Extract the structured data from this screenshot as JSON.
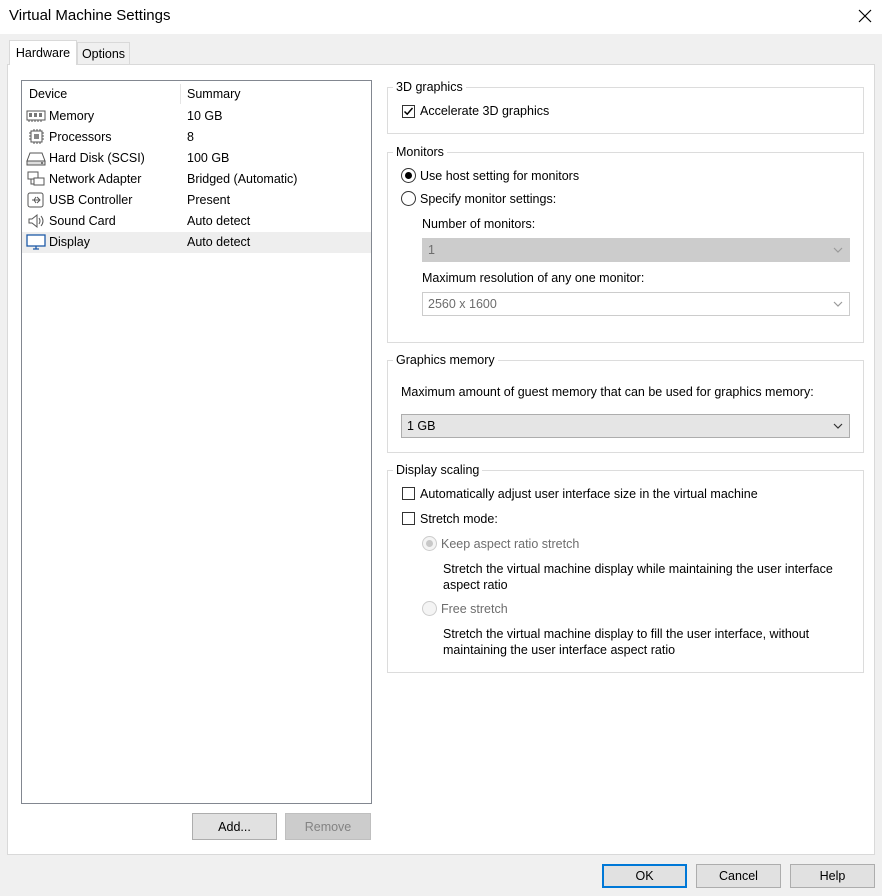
{
  "window": {
    "title": "Virtual Machine Settings"
  },
  "tabs": [
    {
      "label": "Hardware",
      "active": true
    },
    {
      "label": "Options",
      "active": false
    }
  ],
  "device_list": {
    "headers": {
      "device": "Device",
      "summary": "Summary"
    },
    "rows": [
      {
        "icon": "memory-icon",
        "name": "Memory",
        "summary": "10 GB"
      },
      {
        "icon": "processor-icon",
        "name": "Processors",
        "summary": "8"
      },
      {
        "icon": "hard-disk-icon",
        "name": "Hard Disk (SCSI)",
        "summary": "100 GB"
      },
      {
        "icon": "network-adapter-icon",
        "name": "Network Adapter",
        "summary": "Bridged (Automatic)"
      },
      {
        "icon": "usb-icon",
        "name": "USB Controller",
        "summary": "Present"
      },
      {
        "icon": "speaker-icon",
        "name": "Sound Card",
        "summary": "Auto detect"
      },
      {
        "icon": "monitor-icon",
        "name": "Display",
        "summary": "Auto detect",
        "selected": true
      }
    ]
  },
  "list_buttons": {
    "add": "Add...",
    "remove": "Remove"
  },
  "graphics3d": {
    "legend": "3D graphics",
    "accelerate_label": "Accelerate 3D graphics",
    "accelerate_checked": true
  },
  "monitors": {
    "legend": "Monitors",
    "use_host_label": "Use host setting for monitors",
    "specify_label": "Specify monitor settings:",
    "number_label": "Number of monitors:",
    "number_value": "1",
    "maxres_label": "Maximum resolution of any one monitor:",
    "maxres_value": "2560 x 1600"
  },
  "graphics_memory": {
    "legend": "Graphics memory",
    "description": "Maximum amount of guest memory that can be used for graphics memory:",
    "value": "1 GB"
  },
  "display_scaling": {
    "legend": "Display scaling",
    "auto_adjust_label": "Automatically adjust user interface size in the virtual machine",
    "stretch_label": "Stretch mode:",
    "keep_aspect_label": "Keep aspect ratio stretch",
    "keep_aspect_desc_1": "Stretch the virtual machine display while maintaining the user interface",
    "keep_aspect_desc_2": "aspect ratio",
    "free_label": "Free stretch",
    "free_desc_1": "Stretch the virtual machine display to fill the user interface, without",
    "free_desc_2": "maintaining the user interface aspect ratio"
  },
  "footer": {
    "ok": "OK",
    "cancel": "Cancel",
    "help": "Help"
  },
  "colors": {
    "accent": "#0078d7",
    "selected_row": "#eeeeee",
    "disabled_text": "#6d6d6d"
  }
}
